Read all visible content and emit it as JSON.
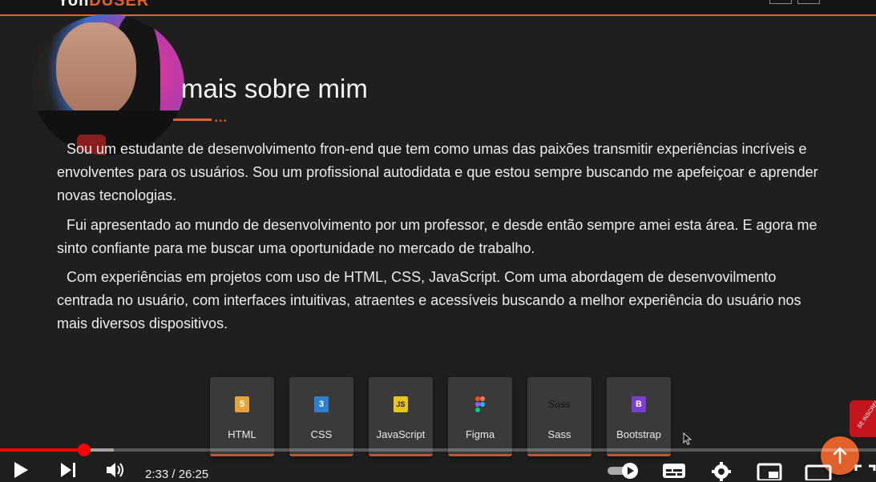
{
  "header": {
    "brand_part1": "Yoh",
    "brand_part2": "DUSER"
  },
  "about": {
    "title": "mais sobre mim",
    "title_dots": "•••",
    "paragraphs": [
      "Sou um estudante de desenvolvimento fron-end que tem como umas das paixões transmitir experiências incríveis e envolventes para os usuários. Sou um profissional autodidata e que estou sempre buscando me apefeiçoar e aprender novas tecnologias.",
      "Fui apresentado ao mundo de desenvolvimento por um professor, e desde então sempre amei esta área. E agora me sinto confiante para me buscar uma oportunidade no mercado de trabalho.",
      "Com experiências em projetos com uso de HTML, CSS, JavaScript. Com uma abordagem de desenvovilmento centrada no usuário, com interfaces intuitivas, atraentes e acessíveis buscando a melhor experiência do usuário nos mais diversos dispositivos."
    ]
  },
  "skills": [
    {
      "name": "HTML",
      "glyph": "5",
      "color": "#e6a23c",
      "icon": "html5-icon"
    },
    {
      "name": "CSS",
      "glyph": "3",
      "color": "#2f7fcf",
      "icon": "css3-icon"
    },
    {
      "name": "JavaScript",
      "glyph": "JS",
      "color": "#e8c619",
      "icon": "javascript-icon"
    },
    {
      "name": "Figma",
      "glyph": "",
      "color": "#f24e1e",
      "icon": "figma-icon"
    },
    {
      "name": "Sass",
      "glyph": "Sass",
      "color": "#3a3a3a",
      "icon": "sass-icon"
    },
    {
      "name": "Bootstrap",
      "glyph": "B",
      "color": "#7a3fd0",
      "icon": "bootstrap-icon"
    }
  ],
  "player": {
    "current_time": "2:33",
    "duration": "26:25",
    "time_display": "2:33 / 26:25",
    "played_fraction": 0.097,
    "buffered_fraction": 0.13,
    "accent": "#ff0000"
  },
  "overlay": {
    "subscribe_label": "SE INSCREVA",
    "scroll_top_color": "#e0622a"
  }
}
